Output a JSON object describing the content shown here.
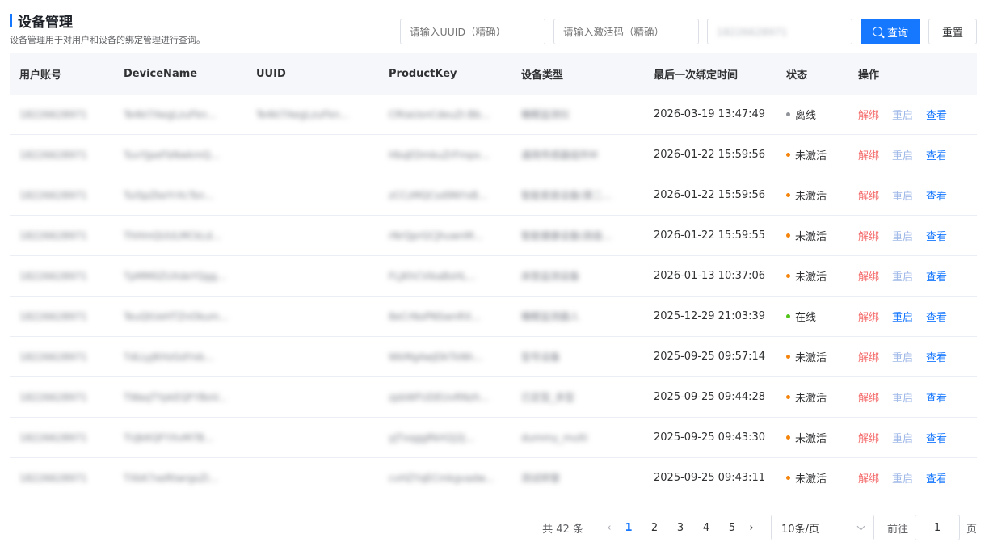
{
  "header": {
    "title": "设备管理",
    "subtitle": "设备管理用于对用户和设备的绑定管理进行查询。"
  },
  "search": {
    "uuid_placeholder": "请输入UUID（精确）",
    "code_placeholder": "请输入激活码（精确）",
    "account_value": "18226628971",
    "query_label": "查询",
    "reset_label": "重置"
  },
  "table": {
    "columns": [
      "用户账号",
      "DeviceName",
      "UUID",
      "ProductKey",
      "设备类型",
      "最后一次绑定时间",
      "状态",
      "操作"
    ],
    "rows": [
      {
        "account": "18226628971",
        "device": "Te4kl7AegLzuFkn...",
        "uuid": "Te4kl7AegLzuFkn...",
        "pkey": "CRtaUsnCdeuZr.Bb...",
        "type": "睡眠监测仪",
        "time": "2026-03-19 13:47:49",
        "status": "离线"
      },
      {
        "account": "18226628971",
        "device": "TuvYJpeFbNwkmQ...",
        "uuid": "",
        "pkey": "HbqEDmkuZrFmpx...",
        "type": "通用传感器组件M",
        "time": "2026-01-22 15:59:56",
        "status": "未激活"
      },
      {
        "account": "18226628971",
        "device": "TuiSpZkeYrXcTsn...",
        "uuid": "",
        "pkey": "zCCzMQCsd9NYxB...",
        "type": "智能家居设备(第二...",
        "time": "2026-01-22 15:59:56",
        "status": "未激活"
      },
      {
        "account": "18226628971",
        "device": "ThHmQUULMCkLd...",
        "uuid": "",
        "pkey": "rNrQprGCJhuwnM...",
        "type": "智能健康设备(高级...",
        "time": "2026-01-22 15:59:55",
        "status": "未激活"
      },
      {
        "account": "18226628971",
        "device": "TpMM0ZUXdeYQgg...",
        "uuid": "",
        "pkey": "FLJKhCVikaBsHL...",
        "type": "床垫监测设备",
        "time": "2026-01-13 10:37:06",
        "status": "未激活"
      },
      {
        "account": "18226628971",
        "device": "TeuQtUeHTZnOkum...",
        "uuid": "",
        "pkey": "8eCrNoPNSwnRX...",
        "type": "睡眠监测器人",
        "time": "2025-12-29 21:03:39",
        "status": "在线"
      },
      {
        "account": "18226628971",
        "device": "TdLLyJKHzGdYxb...",
        "uuid": "",
        "pkey": "WkMgAwJDkTkNh...",
        "type": "型号设备",
        "time": "2025-09-25 09:57:14",
        "status": "未激活"
      },
      {
        "account": "18226628971",
        "device": "TWaqTYpkEQFYBoV...",
        "uuid": "",
        "pkey": "zpbWFUDEUvRNzh...",
        "type": "已定型_多型",
        "time": "2025-09-25 09:44:28",
        "status": "未激活"
      },
      {
        "account": "18226628971",
        "device": "TUJkKQFYXvM7B...",
        "uuid": "",
        "pkey": "yJTxqggRkH2J2J...",
        "type": "dummy_multi",
        "time": "2025-09-25 09:43:30",
        "status": "未激活"
      },
      {
        "account": "18226628971",
        "device": "TXkK7xeRtwrgsZI...",
        "uuid": "",
        "pkey": "cvHZYqECmkgvadw...",
        "type": "测试样管",
        "time": "2025-09-25 09:43:11",
        "status": "未激活"
      }
    ],
    "actions": {
      "unbind": "解绑",
      "restart": "重启",
      "view": "查看"
    }
  },
  "status_colors": {
    "离线": "#909399",
    "未激活": "#f5840c",
    "在线": "#52c41a"
  },
  "pagination": {
    "total": "共 42 条",
    "pages": [
      "1",
      "2",
      "3",
      "4",
      "5"
    ],
    "current": "1",
    "page_size": "10条/页",
    "goto_prefix": "前往",
    "goto_value": "1",
    "goto_suffix": "页"
  }
}
